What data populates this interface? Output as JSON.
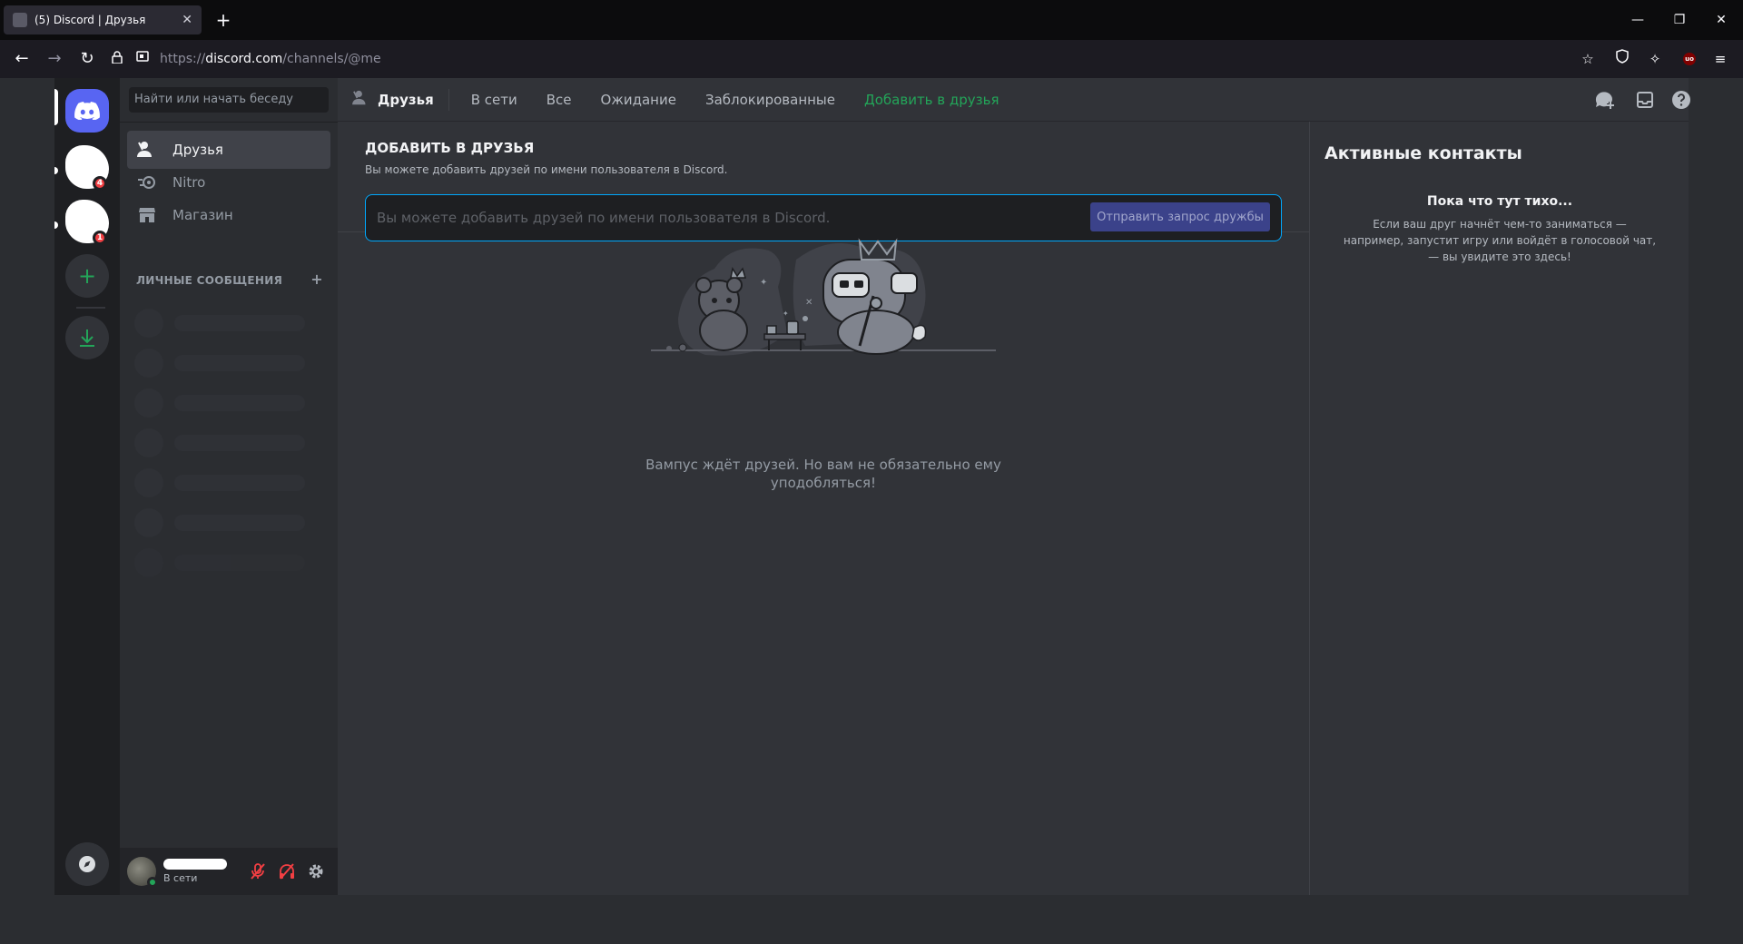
{
  "browser": {
    "tab_title": "(5) Discord | Друзья",
    "url_prefix": "https://",
    "url_host": "discord.com",
    "url_path": "/channels/@me"
  },
  "servers": {
    "badges": [
      "4",
      "1"
    ]
  },
  "sidebar": {
    "search_placeholder": "Найти или начать беседу",
    "nav": [
      {
        "label": "Друзья",
        "icon": "friends-icon"
      },
      {
        "label": "Nitro",
        "icon": "nitro-icon"
      },
      {
        "label": "Магазин",
        "icon": "shop-icon"
      }
    ],
    "dm_header": "ЛИЧНЫЕ СООБЩЕНИЯ",
    "dm_add": "+"
  },
  "user": {
    "status": "В сети"
  },
  "header": {
    "title": "Друзья",
    "tabs": [
      "В сети",
      "Все",
      "Ожидание",
      "Заблокированные"
    ],
    "add_friend": "Добавить в друзья"
  },
  "add_friend": {
    "title": "ДОБАВИТЬ В ДРУЗЬЯ",
    "description": "Вы можете добавить друзей по имени пользователя в Discord.",
    "placeholder": "Вы можете добавить друзей по имени пользователя в Discord.",
    "button": "Отправить запрос дружбы"
  },
  "empty_state": {
    "text": "Вампус ждёт друзей. Но вам не обязательно ему уподобляться!"
  },
  "active_now": {
    "title": "Активные контакты",
    "subtitle": "Пока что тут тихо...",
    "description": "Если ваш друг начнёт чем-то заниматься — например, запустит игру или войдёт в голосовой чат, — вы увидите это здесь!"
  },
  "colors": {
    "accent": "#5865f2",
    "green": "#23a559",
    "red": "#f23f43"
  }
}
